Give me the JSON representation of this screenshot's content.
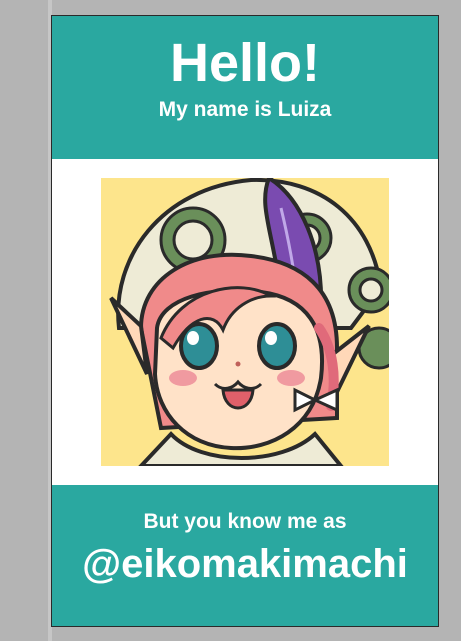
{
  "card": {
    "greeting": "Hello!",
    "name_line": "My name is Luiza",
    "known_as_line": "But you know me as",
    "handle": "@eikomakimachi"
  },
  "avatar": {
    "icon": "chibi-character-portrait",
    "background_color": "#fde58c"
  },
  "colors": {
    "accent": "#2aa8a0",
    "card_background": "#ffffff",
    "workspace_background": "#b4b4b4"
  }
}
